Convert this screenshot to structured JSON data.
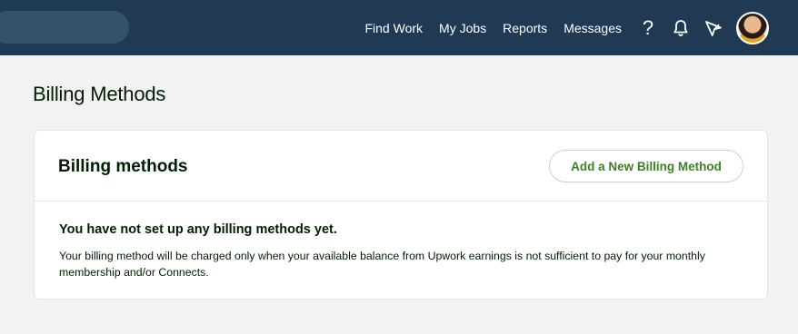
{
  "nav": {
    "links": [
      "Find Work",
      "My Jobs",
      "Reports",
      "Messages"
    ],
    "help_label": "?"
  },
  "page": {
    "title": "Billing Methods"
  },
  "card": {
    "title": "Billing methods",
    "add_button_label": "Add a New Billing Method",
    "empty_title": "You have not set up any billing methods yet.",
    "empty_description": "Your billing method will be charged only when your available balance from Upwork earnings is not sufficient to pay for your monthly membership and/or Connects."
  },
  "colors": {
    "header_bg": "#1f3a52",
    "accent_green": "#3c8224",
    "page_bg": "#f2f2f2"
  },
  "icons": [
    "search-pill",
    "help-icon",
    "bell-icon",
    "send-icon",
    "avatar"
  ]
}
